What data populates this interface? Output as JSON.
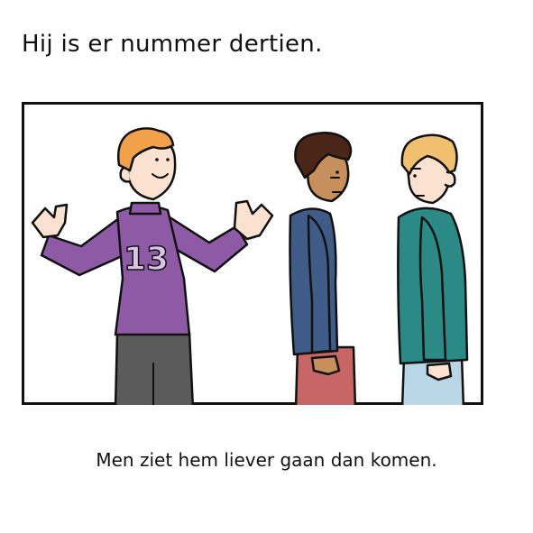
{
  "title": "Hij is er nummer dertien.",
  "caption": "Men ziet hem liever gaan dan komen.",
  "illustration": {
    "jersey_number": "13",
    "colors": {
      "frame": "#111111",
      "skin_light": "#fbe1d0",
      "skin_dark": "#c68f5b",
      "hair_orange": "#f0a14a",
      "hair_blonde": "#f0c070",
      "hair_dark": "#4a2518",
      "sweater_purple": "#8e5aa6",
      "pants_gray": "#5b5b5b",
      "jacket_blue": "#3f5c88",
      "pants_red": "#c86666",
      "jacket_teal": "#2b8a85",
      "pants_lightblue": "#b9d6e6"
    }
  }
}
